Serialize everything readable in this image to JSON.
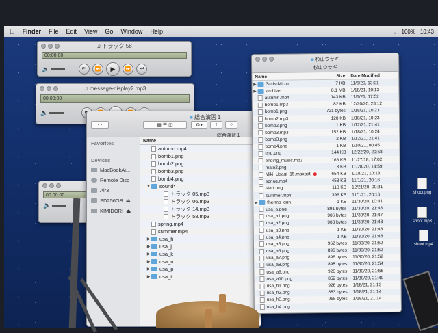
{
  "menubar": {
    "app": "Finder",
    "items": [
      "File",
      "Edit",
      "View",
      "Go",
      "Window",
      "Help"
    ],
    "battery": "100%",
    "time": "10:43"
  },
  "player1": {
    "title": "トラック 58",
    "time": "00:00:00"
  },
  "player2": {
    "title": "message-display2.mp3",
    "time": "00:00:00"
  },
  "player3": {
    "time": "00:00:00"
  },
  "finder1": {
    "title": "総合演習１",
    "path": "総合演習１",
    "column": "Name",
    "sidebar": {
      "favorites": "Favorites",
      "devices": "Devices",
      "items": [
        "MacBookAi...",
        "Remote Disc",
        "Air3",
        "SD256GB",
        "KIMIDORI"
      ]
    },
    "rows": [
      {
        "name": "autumn.mp4",
        "kind": "file",
        "indent": 1
      },
      {
        "name": "bomb1.png",
        "kind": "file",
        "indent": 1
      },
      {
        "name": "bomb2.png",
        "kind": "file",
        "indent": 1
      },
      {
        "name": "bomb3.png",
        "kind": "file",
        "indent": 1
      },
      {
        "name": "bomb4.png",
        "kind": "file",
        "indent": 1
      },
      {
        "name": "sound*",
        "kind": "folder-open",
        "indent": 1
      },
      {
        "name": "トラック 05.mp3",
        "kind": "file",
        "indent": 2
      },
      {
        "name": "トラック 06.mp3",
        "kind": "file",
        "indent": 2
      },
      {
        "name": "トラック 14.mp3",
        "kind": "file",
        "indent": 2
      },
      {
        "name": "トラック 58.mp3",
        "kind": "file",
        "indent": 2
      },
      {
        "name": "spring.mp4",
        "kind": "file",
        "indent": 1
      },
      {
        "name": "summer.mp4",
        "kind": "file",
        "indent": 1
      },
      {
        "name": "usa_h",
        "kind": "folder",
        "indent": 1
      },
      {
        "name": "usa_j",
        "kind": "folder",
        "indent": 1
      },
      {
        "name": "usa_k",
        "kind": "folder",
        "indent": 1
      },
      {
        "name": "usa_n",
        "kind": "folder",
        "indent": 1
      },
      {
        "name": "usa_p",
        "kind": "folder",
        "indent": 1
      },
      {
        "name": "usa_t",
        "kind": "folder",
        "indent": 1
      }
    ]
  },
  "finder2": {
    "title": "杉山ウサギ",
    "subtitle": "杉山ウサギ",
    "columns": [
      "Name",
      "Size",
      "Date Modified"
    ],
    "rows": [
      [
        "3axis-Micro",
        "7 KB",
        "11/6/20, 13:01",
        "folder"
      ],
      [
        "archive",
        "8.1 MB",
        "1/18/21, 10:13",
        "folder"
      ],
      [
        "autumn.mp4",
        "143 KB",
        "11/1/21, 17:52",
        "file"
      ],
      [
        "bomb1.mp3",
        "82 KB",
        "12/20/20, 23:12",
        "file"
      ],
      [
        "bomb1.png",
        "721 bytes",
        "1/18/21, 10:23",
        "file"
      ],
      [
        "bomb2.mp3",
        "120 KB",
        "1/18/21, 10:23",
        "file"
      ],
      [
        "bomb2.png",
        "1 KB",
        "1/12/21, 21:41",
        "file"
      ],
      [
        "bomb3.mp3",
        "152 KB",
        "1/18/21, 10:24",
        "file"
      ],
      [
        "bomb3.png",
        "2 KB",
        "1/12/21, 21:41",
        "file"
      ],
      [
        "bomb4.png",
        "1 KB",
        "1/10/21, 00:45",
        "file"
      ],
      [
        "end.png",
        "144 KB",
        "12/22/20, 20:58",
        "file"
      ],
      [
        "ending_music.mp3",
        "166 KB",
        "11/27/18, 17:02",
        "file"
      ],
      [
        "mato2.png",
        "3 KB",
        "11/28/20, 14:59",
        "file"
      ],
      [
        "Miki_Usagi_15.maxpat",
        "654 KB",
        "1/18/21, 10:13",
        "maxpat"
      ],
      [
        "spring.mp4",
        "453 KB",
        "11/1/21, 20:16",
        "file"
      ],
      [
        "start.png",
        "110 KB",
        "12/21/20, 00:31",
        "file"
      ],
      [
        "summer.mp4",
        "396 KB",
        "11/1/21, 20:16",
        "file"
      ],
      [
        "thermo_gun",
        "1 KB",
        "11/30/20, 10:41",
        "folder"
      ],
      [
        "usa_a.png",
        "891 bytes",
        "11/30/20, 21:48",
        "file"
      ],
      [
        "usa_a1.png",
        "906 bytes",
        "11/30/20, 21:47",
        "file"
      ],
      [
        "usa_a2.png",
        "908 bytes",
        "11/30/20, 21:48",
        "file"
      ],
      [
        "usa_a3.png",
        "1 KB",
        "11/30/20, 21:48",
        "file"
      ],
      [
        "usa_a4.png",
        "1 KB",
        "11/30/20, 21:48",
        "file"
      ],
      [
        "usa_a5.png",
        "962 bytes",
        "11/30/20, 21:52",
        "file"
      ],
      [
        "usa_a6.png",
        "896 bytes",
        "11/30/20, 21:52",
        "file"
      ],
      [
        "usa_a7.png",
        "896 bytes",
        "11/30/20, 21:52",
        "file"
      ],
      [
        "usa_a8.png",
        "898 bytes",
        "11/30/20, 21:54",
        "file"
      ],
      [
        "usa_a9.png",
        "920 bytes",
        "11/30/20, 21:55",
        "file"
      ],
      [
        "usa_a10.png",
        "852 bytes",
        "11/30/20, 21:49",
        "file"
      ],
      [
        "usa_h1.png",
        "926 bytes",
        "1/18/21, 21:13",
        "file"
      ],
      [
        "usa_h2.png",
        "883 bytes",
        "1/18/21, 21:14",
        "file"
      ],
      [
        "usa_h3.png",
        "965 bytes",
        "1/18/21, 21:14",
        "file"
      ],
      [
        "usa_h4.png",
        "",
        "",
        "file"
      ]
    ]
  },
  "desktop": [
    {
      "name": "shoot.png"
    },
    {
      "name": "shoot.mp3"
    },
    {
      "name": "shoot.mp4"
    }
  ]
}
